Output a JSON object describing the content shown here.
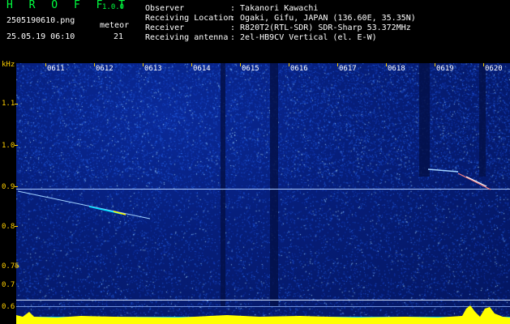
{
  "header": {
    "app_title": "H R O F F T",
    "version": "1.0.0",
    "filename": "2505190610.png",
    "datetime": "25.05.19 06:10",
    "meteor_label": "meteor",
    "meteor_count": "21",
    "info": [
      {
        "label": "Observer",
        "value": ": Takanori Kawachi"
      },
      {
        "label": "Receiving Location",
        "value": ": Ogaki, Gifu, JAPAN (136.60E, 35.35N)"
      },
      {
        "label": "Receiver",
        "value": ": R820T2(RTL-SDR) SDR-Sharp 53.372MHz"
      },
      {
        "label": "Receiving antenna",
        "value": ": 2el-HB9CV Vertical (el. E-W)"
      }
    ]
  },
  "axis": {
    "unit": "kHz",
    "y_ticks": [
      "1.1",
      "1.0",
      "0.9",
      "0.8",
      "0.75",
      "0.7",
      "0.6"
    ],
    "time_labels": [
      "0611",
      "0612",
      "0613",
      "0614",
      "0615",
      "0616",
      "0617",
      "0618",
      "0619",
      "0620"
    ]
  },
  "colors": {
    "title_green": "#00ff40",
    "axis_yellow": "#ffd000",
    "carrier": "#a8c8ff",
    "meteor_yellow": "#ffff00",
    "meteor_cyan": "#00e0ff"
  }
}
